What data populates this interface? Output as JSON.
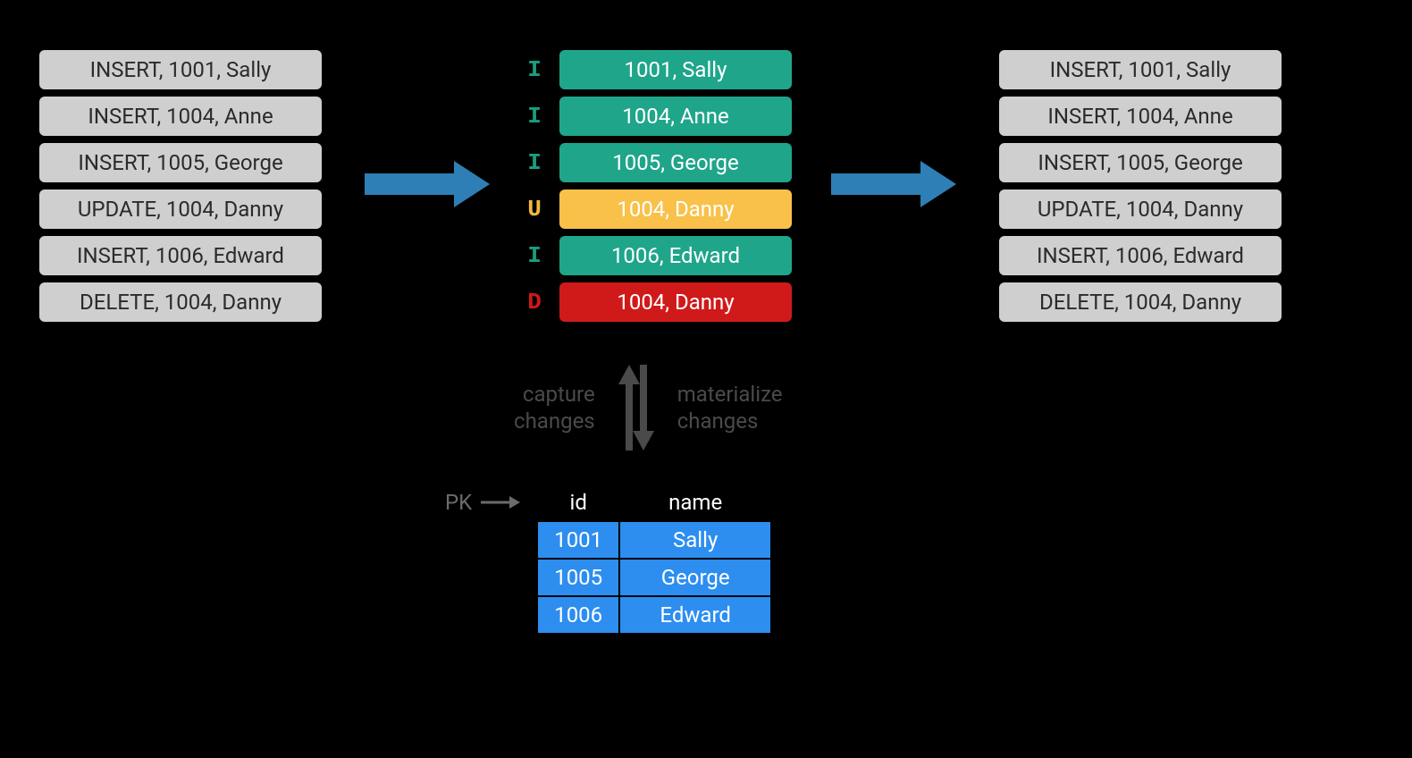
{
  "left_stream": [
    "INSERT, 1001, Sally",
    "INSERT, 1004, Anne",
    "INSERT, 1005, George",
    "UPDATE, 1004, Danny",
    "INSERT, 1006, Edward",
    "DELETE, 1004, Danny"
  ],
  "right_stream": [
    "INSERT, 1001, Sally",
    "INSERT, 1004, Anne",
    "INSERT, 1005, George",
    "UPDATE, 1004, Danny",
    "INSERT, 1006, Edward",
    "DELETE, 1004, Danny"
  ],
  "center_ops": [
    {
      "op": "I",
      "text": "1001, Sally"
    },
    {
      "op": "I",
      "text": "1004, Anne"
    },
    {
      "op": "I",
      "text": "1005, George"
    },
    {
      "op": "U",
      "text": "1004, Danny"
    },
    {
      "op": "I",
      "text": "1006, Edward"
    },
    {
      "op": "D",
      "text": "1004, Danny"
    }
  ],
  "exchange": {
    "left_line1": "capture",
    "left_line2": "changes",
    "right_line1": "materialize",
    "right_line2": "changes"
  },
  "pk_label": "PK",
  "table": {
    "headers": {
      "id": "id",
      "name": "name"
    },
    "rows": [
      {
        "id": "1001",
        "name": "Sally"
      },
      {
        "id": "1005",
        "name": "George"
      },
      {
        "id": "1006",
        "name": "Edward"
      }
    ]
  }
}
